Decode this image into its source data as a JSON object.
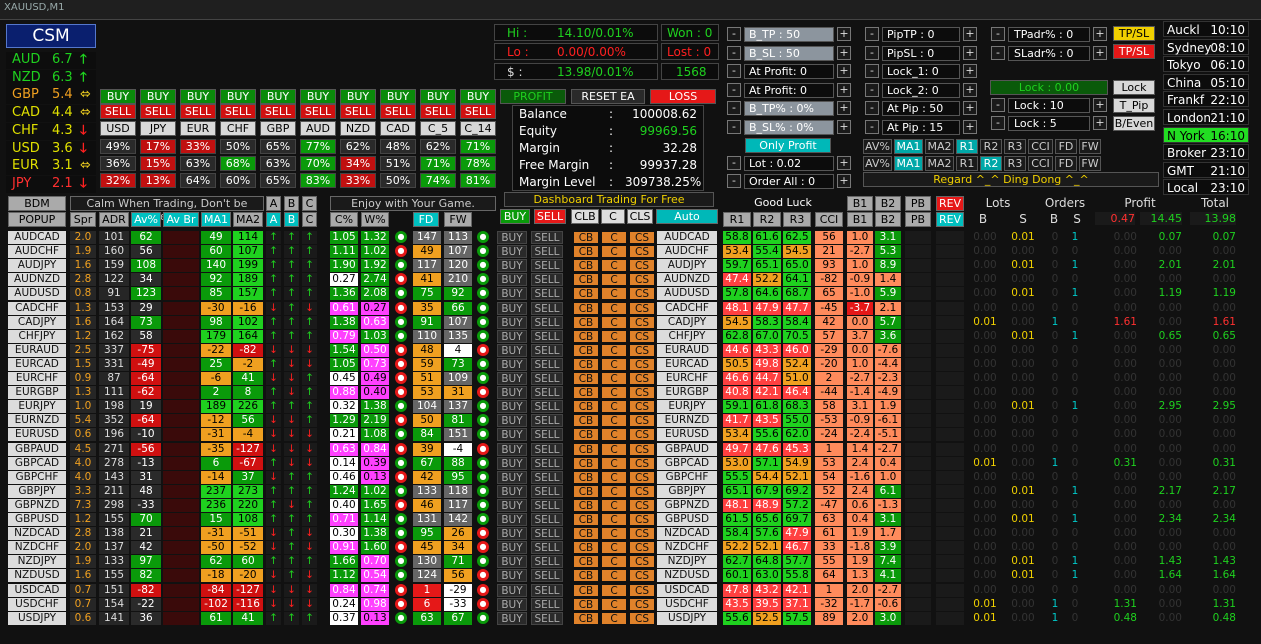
{
  "window_title": "XAUUSD,M1",
  "csm": {
    "title": "CSM",
    "currencies": [
      {
        "name": "AUD",
        "value": "6.7",
        "arrow": "🡑",
        "color": "#1fd11f",
        "arrow_color": "#1fd11f"
      },
      {
        "name": "NZD",
        "value": "6.3",
        "arrow": "🡑",
        "color": "#1fd11f",
        "arrow_color": "#1fd11f"
      },
      {
        "name": "GBP",
        "value": "5.4",
        "arrow": "⬄",
        "color": "#f0a020",
        "arrow_color": "#f0d020"
      },
      {
        "name": "CAD",
        "value": "4.4",
        "arrow": "⬄",
        "color": "#e0e000",
        "arrow_color": "#f0d020"
      },
      {
        "name": "CHF",
        "value": "4.3",
        "arrow": "🡓",
        "color": "#e0e000",
        "arrow_color": "#ff2020"
      },
      {
        "name": "USD",
        "value": "3.6",
        "arrow": "🡓",
        "color": "#e0e000",
        "arrow_color": "#ff2020"
      },
      {
        "name": "EUR",
        "value": "3.1",
        "arrow": "⬄",
        "color": "#e0e000",
        "arrow_color": "#f0d020"
      },
      {
        "name": "JPY",
        "value": "2.1",
        "arrow": "🡓",
        "color": "#ff3030",
        "arrow_color": "#ff2020"
      }
    ]
  },
  "ccy_grid": {
    "buy": "BUY",
    "sell": "SELL",
    "labels": [
      "USD",
      "JPY",
      "EUR",
      "CHF",
      "GBP",
      "AUD",
      "NZD",
      "CAD",
      "C_5",
      "C_14"
    ],
    "pct_rows": [
      [
        "49%",
        "17%",
        "33%",
        "50%",
        "65%",
        "77%",
        "62%",
        "48%",
        "62%",
        "71%"
      ],
      [
        "36%",
        "15%",
        "63%",
        "68%",
        "63%",
        "70%",
        "34%",
        "51%",
        "71%",
        "78%"
      ],
      [
        "32%",
        "13%",
        "64%",
        "60%",
        "65%",
        "83%",
        "33%",
        "50%",
        "74%",
        "81%"
      ]
    ],
    "pct_colors": [
      [
        "#2a2a2a",
        "#c01010",
        "#c01010",
        "#2a2a2a",
        "#2a2a2a",
        "#0a9a0a",
        "#2a2a2a",
        "#2a2a2a",
        "#2a2a2a",
        "#0a9a0a"
      ],
      [
        "#2a2a2a",
        "#c01010",
        "#2a2a2a",
        "#0a9a0a",
        "#2a2a2a",
        "#0a9a0a",
        "#c01010",
        "#2a2a2a",
        "#0a9a0a",
        "#0a9a0a"
      ],
      [
        "#c01010",
        "#c01010",
        "#2a2a2a",
        "#2a2a2a",
        "#2a2a2a",
        "#0a9a0a",
        "#c01010",
        "#2a2a2a",
        "#0a9a0a",
        "#0a9a0a"
      ]
    ]
  },
  "stats": {
    "hi_label": "Hi :",
    "hi_value": "14.10/0.01%",
    "lo_label": "Lo :",
    "lo_value": "0.00/0.00%",
    "margin_label": "$ :",
    "margin_value": "13.98/0.01%",
    "won": "Won : 0",
    "lost": "Lost : 0",
    "count": "1568"
  },
  "account": {
    "profit_btn": "PROFIT",
    "reset_btn": "RESET EA",
    "loss_btn": "LOSS",
    "rows": [
      {
        "label": "Balance",
        "value": "100008.62"
      },
      {
        "label": "Equity",
        "value": "99969.56"
      },
      {
        "label": "Margin",
        "value": "32.28"
      },
      {
        "label": "Free Margin",
        "value": "99937.28"
      },
      {
        "label": "Margin Level",
        "value": "309738.25%"
      }
    ],
    "banner": "Dashboard Trading For Free"
  },
  "controls_col1": [
    {
      "label": "B_TP : 50",
      "style": "gray"
    },
    {
      "label": "B_SL : 50",
      "style": "gray"
    },
    {
      "label": "At Profit: 0",
      "style": "dark"
    },
    {
      "label": "At Profit: 0",
      "style": "dark"
    },
    {
      "label": "B_TP% : 0%",
      "style": "gray"
    },
    {
      "label": "B_SL% : 0%",
      "style": "gray"
    }
  ],
  "controls_col2": [
    "PipTP : 0",
    "PipSL : 0",
    "Lock_1: 0",
    "Lock_2: 0",
    "At Pip : 50",
    "At Pip : 15"
  ],
  "controls_col3": [
    "TPadr% : 0",
    "SLadr% : 0"
  ],
  "tp_sl_1": "TP/SL",
  "tp_sl_2": "TP/SL",
  "lock": {
    "value": "Lock : 0.00",
    "btn": "Lock",
    "tpip": "T_Pip",
    "beven": "B/Even",
    "lock10": "Lock : 10",
    "lock5": "Lock : 5"
  },
  "only_profit": "Only Profit",
  "lot": "Lot : 0.02",
  "order_all": "Order All : 0",
  "ind_rows": [
    [
      "AV%",
      "MA1",
      "MA2",
      "R1",
      "R2",
      "R3",
      "CCI",
      "FD",
      "FW"
    ],
    [
      "AV%",
      "MA1",
      "MA2",
      "R1",
      "R2",
      "R3",
      "CCI",
      "FD",
      "FW"
    ]
  ],
  "regard": "Regard     ^_^ Ding Dong ^_^",
  "good_luck": "Good Luck",
  "clocks": [
    {
      "city": "Auckl",
      "time": "10:10",
      "active": false
    },
    {
      "city": "Sydney",
      "time": "08:10",
      "active": false
    },
    {
      "city": "Tokyo",
      "time": "06:10",
      "active": false
    },
    {
      "city": "China",
      "time": "05:10",
      "active": false
    },
    {
      "city": "Frankf",
      "time": "22:10",
      "active": false
    },
    {
      "city": "London",
      "time": "21:10",
      "active": false
    },
    {
      "city": "N York",
      "time": "16:10",
      "active": true
    },
    {
      "city": "Broker",
      "time": "23:10",
      "active": false
    },
    {
      "city": "GMT",
      "time": "21:10",
      "active": false
    },
    {
      "city": "Local",
      "time": "23:10",
      "active": false
    }
  ],
  "table_header": {
    "bdm": "BDM",
    "popup": "POPUP",
    "motto": "Calm When Trading, Don't be Greedy",
    "enjoy": "Enjoy with Your Game.",
    "a": "A",
    "b": "B",
    "c": "C",
    "spr": "Spr",
    "adr": "ADR",
    "avp": "Av%",
    "avbr": "Av Br",
    "ma1": "MA1",
    "ma2": "MA2",
    "cp": "C%",
    "wp": "W%",
    "fd": "FD",
    "fw": "FW",
    "buy": "BUY",
    "sell": "SELL",
    "clb": "CLB",
    "cc": "C",
    "cls": "CLS",
    "auto": "Auto",
    "r1": "R1",
    "r2": "R2",
    "r3": "R3",
    "cci": "CCI",
    "b1": "B1",
    "b2": "B2",
    "pb": "PB",
    "rev": "REV",
    "lots": "Lots",
    "orders": "Orders",
    "profit": "Profit",
    "total": "Total",
    "lb": "B",
    "ls": "S",
    "ob": "B",
    "os": "S",
    "tot_profit_s": "0.47",
    "tot_profit_b": "14.45",
    "tot_total": "13.98"
  },
  "row_buttons": {
    "buy": "BUY",
    "sell": "SELL",
    "cb": "CB",
    "c": "C",
    "cs": "CS"
  },
  "rows": [
    {
      "pair": "AUDCAD",
      "spr": "2.0",
      "adr": "101",
      "av": "62",
      "ma1": "49",
      "ma2": "114",
      "cp": "1.05",
      "wp": "1.32",
      "fd": "147",
      "fw": "113",
      "r1": "58.8",
      "r2": "61.6",
      "r3": "62.5",
      "cci": "56",
      "b1": "1.0",
      "b2": "3.1",
      "lb": "0.00",
      "ls": "0.01",
      "ob": "0",
      "os": "1",
      "ps": "0.00",
      "pb": "0.07",
      "tot": "0.07"
    },
    {
      "pair": "AUDCHF",
      "spr": "1.9",
      "adr": "160",
      "av": "56",
      "ma1": "60",
      "ma2": "107",
      "cp": "1.11",
      "wp": "1.02",
      "fd": "49",
      "fw": "107",
      "r1": "53.4",
      "r2": "55.4",
      "r3": "54.5",
      "cci": "21",
      "b1": "-2.7",
      "b2": "5.3",
      "lb": "0.00",
      "ls": "0.00",
      "ob": "0",
      "os": "0",
      "ps": "0.00",
      "pb": "0.00",
      "tot": "0.00"
    },
    {
      "pair": "AUDJPY",
      "spr": "1.6",
      "adr": "159",
      "av": "108",
      "ma1": "140",
      "ma2": "199",
      "cp": "1.90",
      "wp": "1.92",
      "fd": "117",
      "fw": "120",
      "r1": "59.7",
      "r2": "65.1",
      "r3": "65.0",
      "cci": "93",
      "b1": "1.0",
      "b2": "8.9",
      "lb": "0.00",
      "ls": "0.01",
      "ob": "0",
      "os": "1",
      "ps": "0.00",
      "pb": "2.01",
      "tot": "2.01"
    },
    {
      "pair": "AUDNZD",
      "spr": "2.8",
      "adr": "122",
      "av": "34",
      "ma1": "92",
      "ma2": "189",
      "cp": "0.27",
      "wp": "2.74",
      "fd": "41",
      "fw": "210",
      "r1": "47.4",
      "r2": "52.2",
      "r3": "64.1",
      "cci": "-82",
      "b1": "-0.9",
      "b2": "1.4",
      "lb": "0.00",
      "ls": "0.00",
      "ob": "0",
      "os": "0",
      "ps": "0.00",
      "pb": "0.00",
      "tot": "0.00"
    },
    {
      "pair": "AUDUSD",
      "spr": "0.8",
      "adr": "91",
      "av": "123",
      "ma1": "85",
      "ma2": "157",
      "cp": "1.36",
      "wp": "2.08",
      "fd": "75",
      "fw": "92",
      "r1": "57.8",
      "r2": "64.6",
      "r3": "68.7",
      "cci": "65",
      "b1": "-1.0",
      "b2": "5.9",
      "lb": "0.00",
      "ls": "0.01",
      "ob": "0",
      "os": "1",
      "ps": "0.00",
      "pb": "1.19",
      "tot": "1.19"
    },
    {
      "pair": "CADCHF",
      "spr": "1.3",
      "adr": "153",
      "av": "29",
      "ma1": "-30",
      "ma2": "-16",
      "cp": "0.61",
      "wp": "0.27",
      "fd": "35",
      "fw": "66",
      "r1": "48.1",
      "r2": "47.9",
      "r3": "47.7",
      "cci": "-45",
      "b1": "-3.7",
      "b2": "2.1",
      "lb": "0.00",
      "ls": "0.00",
      "ob": "0",
      "os": "0",
      "ps": "0.00",
      "pb": "0.00",
      "tot": "0.00"
    },
    {
      "pair": "CADJPY",
      "spr": "1.6",
      "adr": "164",
      "av": "73",
      "ma1": "98",
      "ma2": "102",
      "cp": "1.38",
      "wp": "0.63",
      "fd": "91",
      "fw": "107",
      "r1": "54.5",
      "r2": "58.3",
      "r3": "58.4",
      "cci": "42",
      "b1": "0.0",
      "b2": "5.7",
      "lb": "0.01",
      "ls": "0.00",
      "ob": "1",
      "os": "0",
      "ps": "1.61",
      "pb": "0.00",
      "tot": "1.61"
    },
    {
      "pair": "CHFJPY",
      "spr": "1.2",
      "adr": "162",
      "av": "58",
      "ma1": "179",
      "ma2": "164",
      "cp": "0.79",
      "wp": "1.03",
      "fd": "110",
      "fw": "135",
      "r1": "62.8",
      "r2": "67.0",
      "r3": "70.5",
      "cci": "57",
      "b1": "3.7",
      "b2": "3.6",
      "lb": "0.00",
      "ls": "0.01",
      "ob": "0",
      "os": "1",
      "ps": "0.00",
      "pb": "0.65",
      "tot": "0.65"
    },
    {
      "pair": "EURAUD",
      "spr": "2.5",
      "adr": "337",
      "av": "-75",
      "ma1": "-22",
      "ma2": "-82",
      "cp": "1.54",
      "wp": "0.50",
      "fd": "48",
      "fw": "4",
      "r1": "44.6",
      "r2": "43.3",
      "r3": "46.0",
      "cci": "-29",
      "b1": "0.0",
      "b2": "-7.6",
      "lb": "0.00",
      "ls": "0.00",
      "ob": "0",
      "os": "0",
      "ps": "0.00",
      "pb": "0.00",
      "tot": "0.00"
    },
    {
      "pair": "EURCAD",
      "spr": "1.5",
      "adr": "331",
      "av": "-49",
      "ma1": "25",
      "ma2": "-2",
      "cp": "1.05",
      "wp": "0.73",
      "fd": "59",
      "fw": "73",
      "r1": "50.5",
      "r2": "49.8",
      "r3": "52.4",
      "cci": "-20",
      "b1": "1.0",
      "b2": "-4.4",
      "lb": "0.00",
      "ls": "0.00",
      "ob": "0",
      "os": "0",
      "ps": "0.00",
      "pb": "0.00",
      "tot": "0.00"
    },
    {
      "pair": "EURCHF",
      "spr": "0.9",
      "adr": "87",
      "av": "-64",
      "ma1": "-6",
      "ma2": "41",
      "cp": "0.45",
      "wp": "0.49",
      "fd": "51",
      "fw": "109",
      "r1": "46.6",
      "r2": "44.7",
      "r3": "51.0",
      "cci": "2",
      "b1": "-2.7",
      "b2": "-2.3",
      "lb": "0.00",
      "ls": "0.00",
      "ob": "0",
      "os": "0",
      "ps": "0.00",
      "pb": "0.00",
      "tot": "0.00"
    },
    {
      "pair": "EURGBP",
      "spr": "1.3",
      "adr": "111",
      "av": "-62",
      "ma1": "2",
      "ma2": "8",
      "cp": "0.88",
      "wp": "0.40",
      "fd": "53",
      "fw": "31",
      "r1": "40.8",
      "r2": "42.1",
      "r3": "46.4",
      "cci": "-44",
      "b1": "-1.4",
      "b2": "-4.9",
      "lb": "0.00",
      "ls": "0.00",
      "ob": "0",
      "os": "0",
      "ps": "0.00",
      "pb": "0.00",
      "tot": "0.00"
    },
    {
      "pair": "EURJPY",
      "spr": "1.0",
      "adr": "198",
      "av": "19",
      "ma1": "189",
      "ma2": "226",
      "cp": "0.32",
      "wp": "1.38",
      "fd": "104",
      "fw": "137",
      "r1": "59.1",
      "r2": "61.8",
      "r3": "68.3",
      "cci": "58",
      "b1": "3.1",
      "b2": "1.9",
      "lb": "0.00",
      "ls": "0.01",
      "ob": "0",
      "os": "1",
      "ps": "0.00",
      "pb": "2.95",
      "tot": "2.95"
    },
    {
      "pair": "EURNZD",
      "spr": "5.4",
      "adr": "352",
      "av": "-64",
      "ma1": "-12",
      "ma2": "56",
      "cp": "1.29",
      "wp": "2.19",
      "fd": "50",
      "fw": "81",
      "r1": "41.7",
      "r2": "43.5",
      "r3": "55.0",
      "cci": "-53",
      "b1": "-0.9",
      "b2": "-6.1",
      "lb": "0.00",
      "ls": "0.00",
      "ob": "0",
      "os": "0",
      "ps": "0.00",
      "pb": "0.00",
      "tot": "0.00"
    },
    {
      "pair": "EURUSD",
      "spr": "0.6",
      "adr": "196",
      "av": "-10",
      "ma1": "-31",
      "ma2": "-4",
      "cp": "0.21",
      "wp": "1.08",
      "fd": "84",
      "fw": "151",
      "r1": "53.4",
      "r2": "55.6",
      "r3": "62.0",
      "cci": "-24",
      "b1": "-2.4",
      "b2": "-5.1",
      "lb": "0.00",
      "ls": "0.00",
      "ob": "0",
      "os": "0",
      "ps": "0.00",
      "pb": "0.00",
      "tot": "0.00"
    },
    {
      "pair": "GBPAUD",
      "spr": "4.5",
      "adr": "271",
      "av": "-56",
      "ma1": "-35",
      "ma2": "-127",
      "cp": "0.63",
      "wp": "0.84",
      "fd": "39",
      "fw": "-4",
      "r1": "49.7",
      "r2": "47.6",
      "r3": "45.3",
      "cci": "1",
      "b1": "1.4",
      "b2": "-2.7",
      "lb": "0.00",
      "ls": "0.00",
      "ob": "0",
      "os": "0",
      "ps": "0.00",
      "pb": "0.00",
      "tot": "0.00"
    },
    {
      "pair": "GBPCAD",
      "spr": "4.0",
      "adr": "278",
      "av": "-13",
      "ma1": "6",
      "ma2": "-67",
      "cp": "0.14",
      "wp": "0.39",
      "fd": "67",
      "fw": "88",
      "r1": "53.0",
      "r2": "57.1",
      "r3": "54.9",
      "cci": "53",
      "b1": "2.4",
      "b2": "0.4",
      "lb": "0.01",
      "ls": "0.00",
      "ob": "1",
      "os": "0",
      "ps": "0.31",
      "pb": "0.00",
      "tot": "0.31"
    },
    {
      "pair": "GBPCHF",
      "spr": "4.0",
      "adr": "143",
      "av": "31",
      "ma1": "-14",
      "ma2": "37",
      "cp": "0.46",
      "wp": "0.13",
      "fd": "42",
      "fw": "95",
      "r1": "55.5",
      "r2": "54.4",
      "r3": "52.1",
      "cci": "54",
      "b1": "-1.6",
      "b2": "1.0",
      "lb": "0.00",
      "ls": "0.00",
      "ob": "0",
      "os": "0",
      "ps": "0.00",
      "pb": "0.00",
      "tot": "0.00"
    },
    {
      "pair": "GBPJPY",
      "spr": "3.3",
      "adr": "211",
      "av": "48",
      "ma1": "237",
      "ma2": "273",
      "cp": "1.24",
      "wp": "1.02",
      "fd": "133",
      "fw": "118",
      "r1": "65.1",
      "r2": "67.9",
      "r3": "69.2",
      "cci": "52",
      "b1": "2.4",
      "b2": "6.1",
      "lb": "0.00",
      "ls": "0.01",
      "ob": "0",
      "os": "1",
      "ps": "0.00",
      "pb": "2.17",
      "tot": "2.17"
    },
    {
      "pair": "GBPNZD",
      "spr": "7.3",
      "adr": "298",
      "av": "-33",
      "ma1": "236",
      "ma2": "220",
      "cp": "0.40",
      "wp": "1.65",
      "fd": "46",
      "fw": "117",
      "r1": "48.1",
      "r2": "48.9",
      "r3": "57.2",
      "cci": "-47",
      "b1": "0.6",
      "b2": "-1.3",
      "lb": "0.00",
      "ls": "0.00",
      "ob": "0",
      "os": "0",
      "ps": "0.00",
      "pb": "0.00",
      "tot": "0.00"
    },
    {
      "pair": "GBPUSD",
      "spr": "1.2",
      "adr": "155",
      "av": "70",
      "ma1": "15",
      "ma2": "108",
      "cp": "0.71",
      "wp": "1.14",
      "fd": "131",
      "fw": "142",
      "r1": "61.5",
      "r2": "65.6",
      "r3": "69.7",
      "cci": "63",
      "b1": "0.4",
      "b2": "3.1",
      "lb": "0.00",
      "ls": "0.01",
      "ob": "0",
      "os": "1",
      "ps": "0.00",
      "pb": "2.34",
      "tot": "2.34"
    },
    {
      "pair": "NZDCAD",
      "spr": "2.8",
      "adr": "138",
      "av": "21",
      "ma1": "-31",
      "ma2": "-51",
      "cp": "0.30",
      "wp": "1.38",
      "fd": "95",
      "fw": "26",
      "r1": "58.4",
      "r2": "57.6",
      "r3": "47.9",
      "cci": "61",
      "b1": "1.9",
      "b2": "1.7",
      "lb": "0.00",
      "ls": "0.00",
      "ob": "0",
      "os": "0",
      "ps": "0.00",
      "pb": "0.00",
      "tot": "0.00"
    },
    {
      "pair": "NZDCHF",
      "spr": "2.0",
      "adr": "137",
      "av": "42",
      "ma1": "-50",
      "ma2": "-52",
      "cp": "0.91",
      "wp": "1.60",
      "fd": "45",
      "fw": "34",
      "r1": "52.2",
      "r2": "52.1",
      "r3": "46.7",
      "cci": "33",
      "b1": "-1.8",
      "b2": "3.9",
      "lb": "0.00",
      "ls": "0.00",
      "ob": "0",
      "os": "0",
      "ps": "0.00",
      "pb": "0.00",
      "tot": "0.00"
    },
    {
      "pair": "NZDJPY",
      "spr": "1.9",
      "adr": "133",
      "av": "97",
      "ma1": "62",
      "ma2": "60",
      "cp": "1.66",
      "wp": "0.70",
      "fd": "130",
      "fw": "71",
      "r1": "62.7",
      "r2": "64.8",
      "r3": "57.7",
      "cci": "55",
      "b1": "1.9",
      "b2": "7.4",
      "lb": "0.00",
      "ls": "0.01",
      "ob": "0",
      "os": "1",
      "ps": "0.00",
      "pb": "1.43",
      "tot": "1.43"
    },
    {
      "pair": "NZDUSD",
      "spr": "1.6",
      "adr": "155",
      "av": "82",
      "ma1": "-18",
      "ma2": "-20",
      "cp": "1.12",
      "wp": "0.54",
      "fd": "124",
      "fw": "56",
      "r1": "60.1",
      "r2": "63.0",
      "r3": "55.8",
      "cci": "64",
      "b1": "1.3",
      "b2": "4.1",
      "lb": "0.00",
      "ls": "0.01",
      "ob": "0",
      "os": "1",
      "ps": "0.00",
      "pb": "1.64",
      "tot": "1.64"
    },
    {
      "pair": "USDCAD",
      "spr": "0.7",
      "adr": "151",
      "av": "-82",
      "ma1": "-84",
      "ma2": "-127",
      "cp": "0.84",
      "wp": "0.74",
      "fd": "1",
      "fw": "-29",
      "r1": "47.8",
      "r2": "43.2",
      "r3": "42.1",
      "cci": "1",
      "b1": "2.0",
      "b2": "-2.7",
      "lb": "0.00",
      "ls": "0.00",
      "ob": "0",
      "os": "0",
      "ps": "0.00",
      "pb": "0.00",
      "tot": "0.00"
    },
    {
      "pair": "USDCHF",
      "spr": "0.7",
      "adr": "154",
      "av": "-22",
      "ma1": "-102",
      "ma2": "-116",
      "cp": "0.24",
      "wp": "0.98",
      "fd": "6",
      "fw": "-33",
      "r1": "43.5",
      "r2": "39.5",
      "r3": "37.1",
      "cci": "-32",
      "b1": "-1.7",
      "b2": "-0.6",
      "lb": "0.01",
      "ls": "0.00",
      "ob": "1",
      "os": "0",
      "ps": "1.31",
      "pb": "0.00",
      "tot": "1.31"
    },
    {
      "pair": "USDJPY",
      "spr": "0.6",
      "adr": "141",
      "av": "36",
      "ma1": "61",
      "ma2": "41",
      "cp": "0.37",
      "wp": "0.13",
      "fd": "63",
      "fw": "67",
      "r1": "55.6",
      "r2": "52.5",
      "r3": "57.5",
      "cci": "89",
      "b1": "2.0",
      "b2": "3.0",
      "lb": "0.01",
      "ls": "0.00",
      "ob": "1",
      "os": "0",
      "ps": "0.48",
      "pb": "0.00",
      "tot": "0.48"
    }
  ],
  "colors": {
    "green": "#1fd11f",
    "red": "#e51818",
    "orange": "#f0a020",
    "pink": "#ff40ff",
    "salmon": "#ff8b5c",
    "cyan": "#00c8c8",
    "yellow": "#f0d000"
  }
}
